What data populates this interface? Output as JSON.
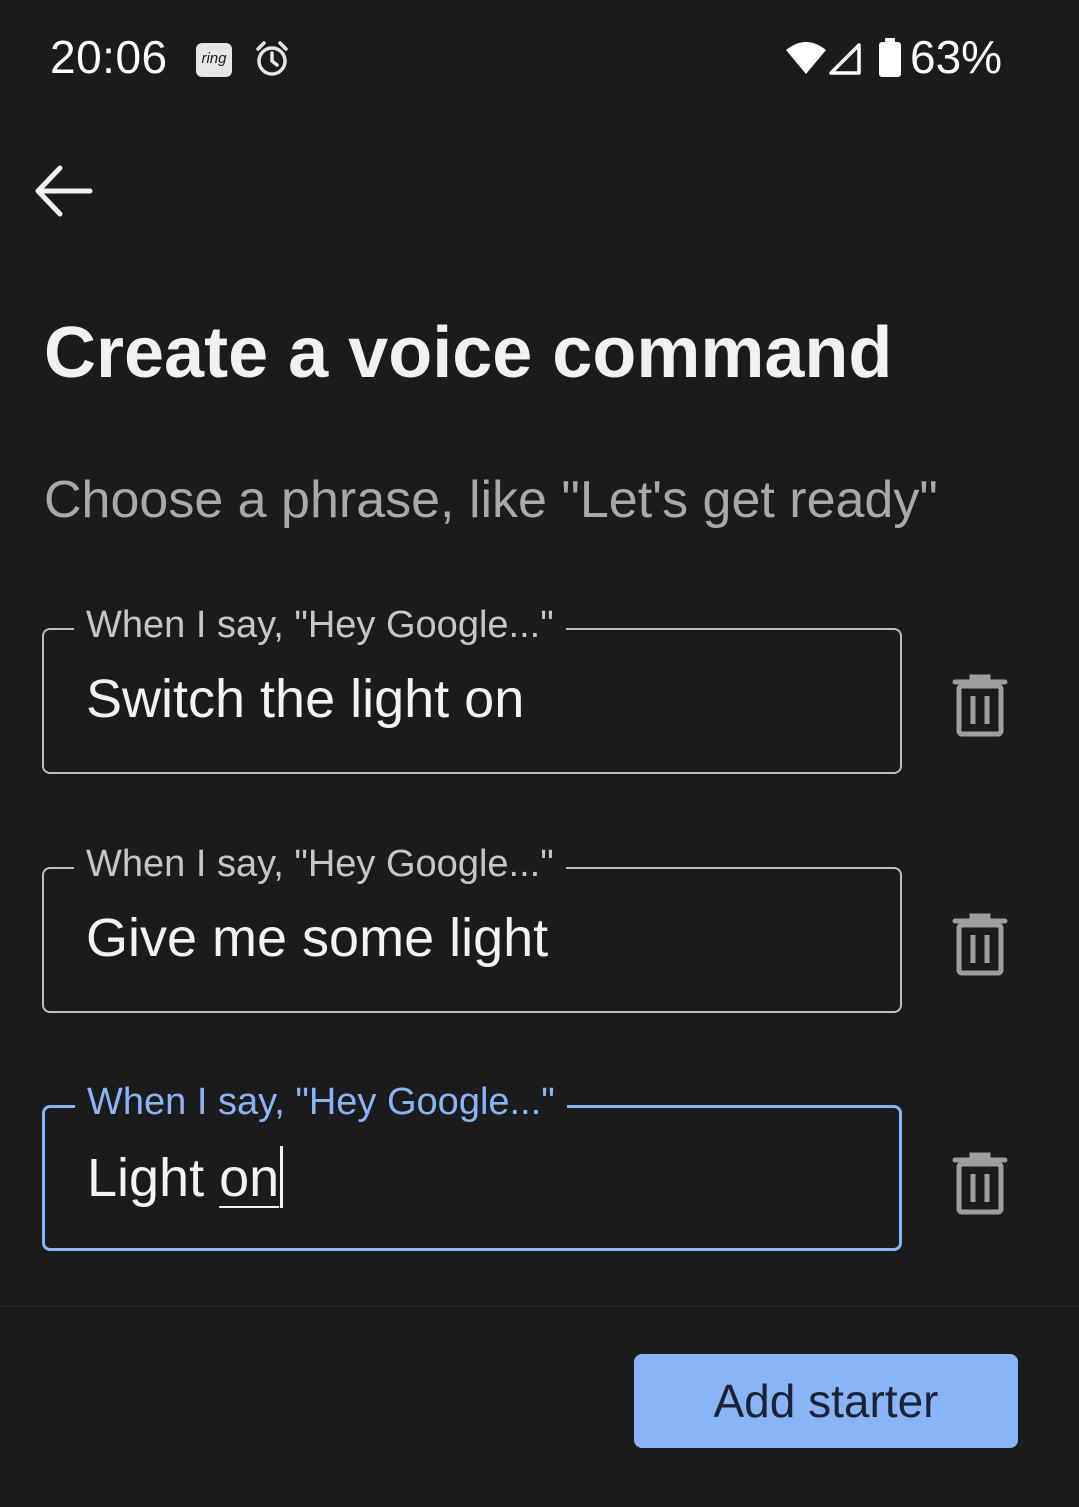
{
  "status_bar": {
    "time": "20:06",
    "notification_icons": [
      "ring-icon",
      "alarm-icon"
    ],
    "ring_label": "ring",
    "system_icons": [
      "wifi-icon",
      "signal-icon",
      "battery-icon"
    ],
    "battery_percent": "63%",
    "battery_level": 0.63
  },
  "header": {
    "back_icon": "arrow-left-icon"
  },
  "main": {
    "title": "Create a voice command",
    "subtitle": "Choose a phrase, like \"Let's get ready\"",
    "phrases": [
      {
        "label": "When I say, \"Hey Google...\"",
        "value": "Switch the light on",
        "focused": false
      },
      {
        "label": "When I say, \"Hey Google...\"",
        "value": "Give me some light",
        "focused": false
      },
      {
        "label": "When I say, \"Hey Google...\"",
        "value_prefix": "Light ",
        "value_underlined": "on",
        "focused": true
      }
    ],
    "delete_icon": "trash-icon"
  },
  "footer": {
    "add_button_label": "Add starter"
  },
  "colors": {
    "background": "#1b1b1c",
    "accent": "#8ab4f8",
    "field_border": "#bdbdbd",
    "subtitle_text": "#a9a9a9"
  }
}
